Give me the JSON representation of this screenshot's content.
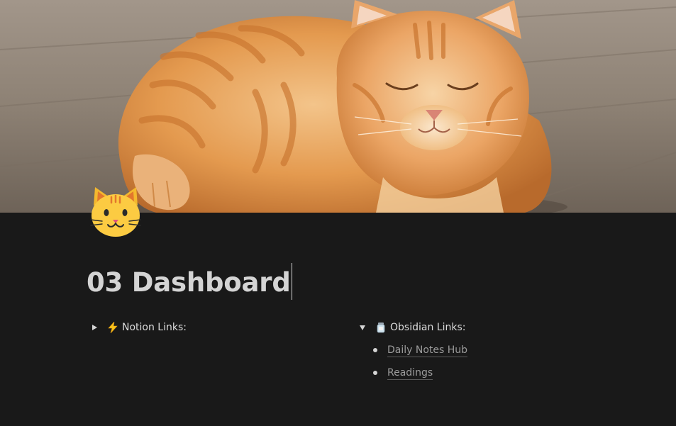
{
  "cover": {
    "subject": "sleeping orange tabby cat on wooden floor"
  },
  "page": {
    "icon": "cat-face-icon",
    "title": "03 Dashboard"
  },
  "toggles": [
    {
      "icon": "lightning-icon",
      "label": "Notion Links:",
      "expanded": false,
      "items": []
    },
    {
      "icon": "jar-icon",
      "label": "Obsidian Links:",
      "expanded": true,
      "items": [
        {
          "label": "Daily Notes Hub"
        },
        {
          "label": "Readings"
        }
      ]
    }
  ],
  "colors": {
    "background": "#191919",
    "text": "#d4d4d4",
    "link": "#9b9b9b",
    "lightning": "#f7c21b"
  }
}
